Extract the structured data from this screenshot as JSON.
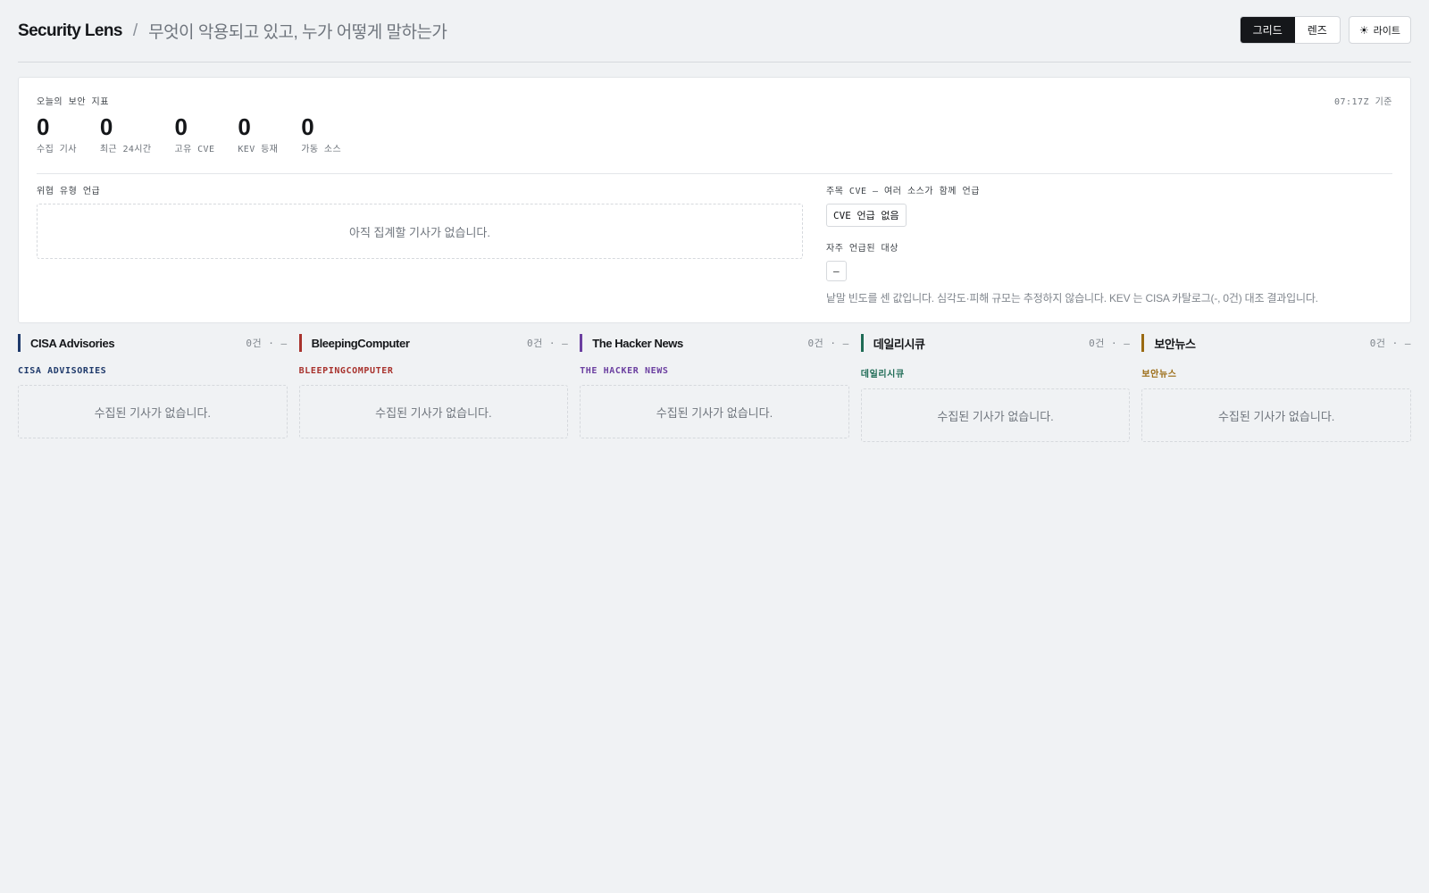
{
  "header": {
    "brand": "Security Lens",
    "separator": "/",
    "subtitle": "무엇이 악용되고 있고, 누가 어떻게 말하는가",
    "view_toggle": {
      "grid": "그리드",
      "lens": "렌즈",
      "active": "grid"
    },
    "theme": {
      "icon": "sun-icon",
      "label": "라이트"
    }
  },
  "indicators": {
    "label": "오늘의 보안 지표",
    "timestamp": "07:17Z 기준",
    "stats": [
      {
        "value": "0",
        "label": "수집 기사"
      },
      {
        "value": "0",
        "label": "최근 24시간"
      },
      {
        "value": "0",
        "label": "고유 CVE"
      },
      {
        "value": "0",
        "label": "KEV 등재"
      },
      {
        "value": "0",
        "label": "가동 소스"
      }
    ],
    "threat_types": {
      "label": "위협 유형 언급",
      "empty": "아직 집계할 기사가 없습니다."
    },
    "cve": {
      "label": "주목 CVE — 여러 소스가 함께 언급",
      "chip": "CVE 언급 없음"
    },
    "targets": {
      "label": "자주 언급된 대상",
      "chip": "—"
    },
    "note": "낱말 빈도를 센 값입니다. 심각도·피해 규모는 추정하지 않습니다. KEV 는 CISA 카탈로그(-, 0건) 대조 결과입니다."
  },
  "colors": {
    "cisa": "#1f3a6b",
    "bleeping": "#a8322d",
    "hackernews": "#6b3fa0",
    "dailysecu": "#1e6b55",
    "boannews": "#9a6a12"
  },
  "columns": [
    {
      "title": "CISA Advisories",
      "meta": "0건 · —",
      "source": "CISA ADVISORIES",
      "color": "#1f3a6b",
      "empty": "수집된 기사가 없습니다."
    },
    {
      "title": "BleepingComputer",
      "meta": "0건 · —",
      "source": "BLEEPINGCOMPUTER",
      "color": "#a8322d",
      "empty": "수집된 기사가 없습니다."
    },
    {
      "title": "The Hacker News",
      "meta": "0건 · —",
      "source": "THE HACKER NEWS",
      "color": "#6b3fa0",
      "empty": "수집된 기사가 없습니다."
    },
    {
      "title": "데일리시큐",
      "meta": "0건 · —",
      "source": "데일리시큐",
      "color": "#1e6b55",
      "empty": "수집된 기사가 없습니다."
    },
    {
      "title": "보안뉴스",
      "meta": "0건 · —",
      "source": "보안뉴스",
      "color": "#9a6a12",
      "empty": "수집된 기사가 없습니다."
    }
  ]
}
